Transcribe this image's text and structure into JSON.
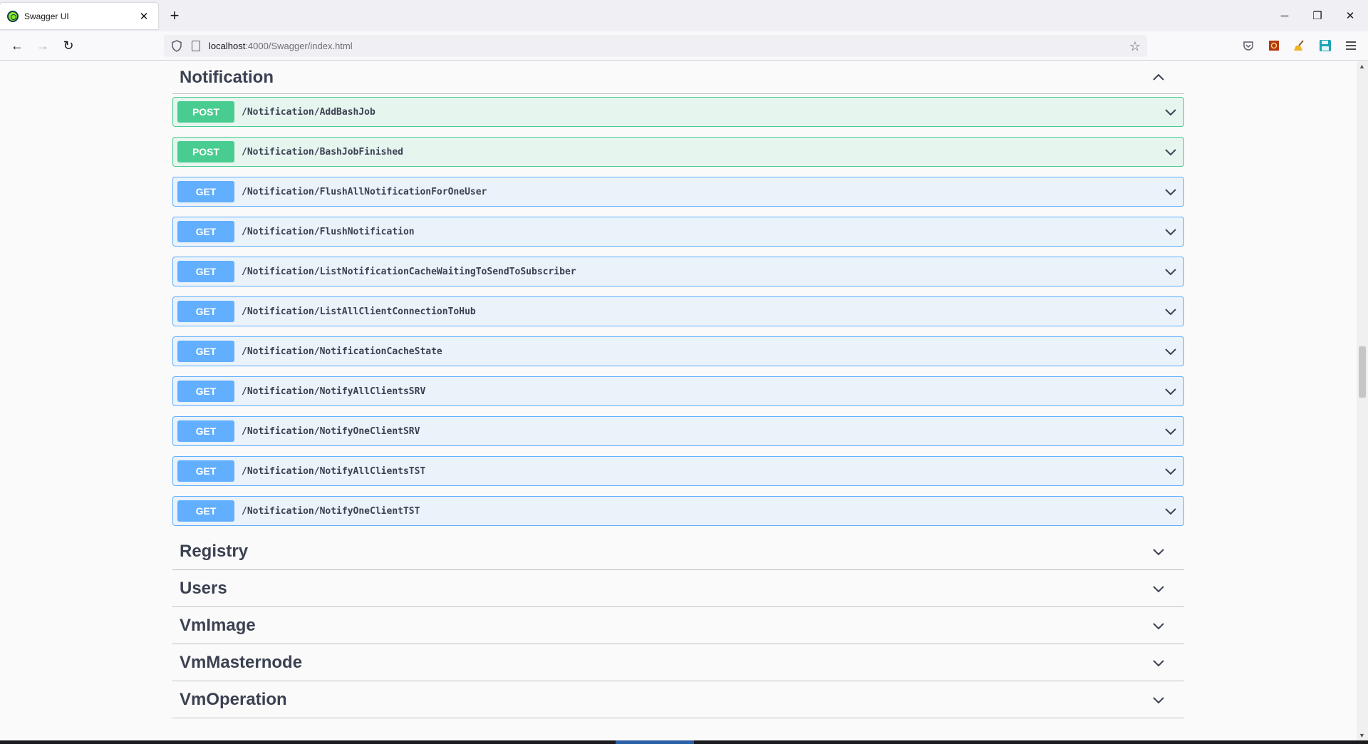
{
  "browser": {
    "tab_title": "Swagger UI",
    "tab_close": "✕",
    "new_tab": "+",
    "url_host": "localhost",
    "url_rest": ":4000/Swagger/index.html",
    "back_icon": "←",
    "forward_icon": "→",
    "reload_icon": "↻",
    "star_icon": "☆",
    "minimize": "─",
    "restore": "❐",
    "close": "✕"
  },
  "section": {
    "title": "Notification",
    "expanded": true
  },
  "operations": [
    {
      "method": "POST",
      "path": "/Notification/AddBashJob"
    },
    {
      "method": "POST",
      "path": "/Notification/BashJobFinished"
    },
    {
      "method": "GET",
      "path": "/Notification/FlushAllNotificationForOneUser"
    },
    {
      "method": "GET",
      "path": "/Notification/FlushNotification"
    },
    {
      "method": "GET",
      "path": "/Notification/ListNotificationCacheWaitingToSendToSubscriber"
    },
    {
      "method": "GET",
      "path": "/Notification/ListAllClientConnectionToHub"
    },
    {
      "method": "GET",
      "path": "/Notification/NotificationCacheState"
    },
    {
      "method": "GET",
      "path": "/Notification/NotifyAllClientsSRV"
    },
    {
      "method": "GET",
      "path": "/Notification/NotifyOneClientSRV"
    },
    {
      "method": "GET",
      "path": "/Notification/NotifyAllClientsTST"
    },
    {
      "method": "GET",
      "path": "/Notification/NotifyOneClientTST"
    }
  ],
  "collapsed_sections": [
    {
      "title": "Registry"
    },
    {
      "title": "Users"
    },
    {
      "title": "VmImage"
    },
    {
      "title": "VmMasternode"
    },
    {
      "title": "VmOperation"
    }
  ],
  "colors": {
    "post": "#49cc90",
    "get": "#61affe",
    "text": "#3b4151"
  }
}
